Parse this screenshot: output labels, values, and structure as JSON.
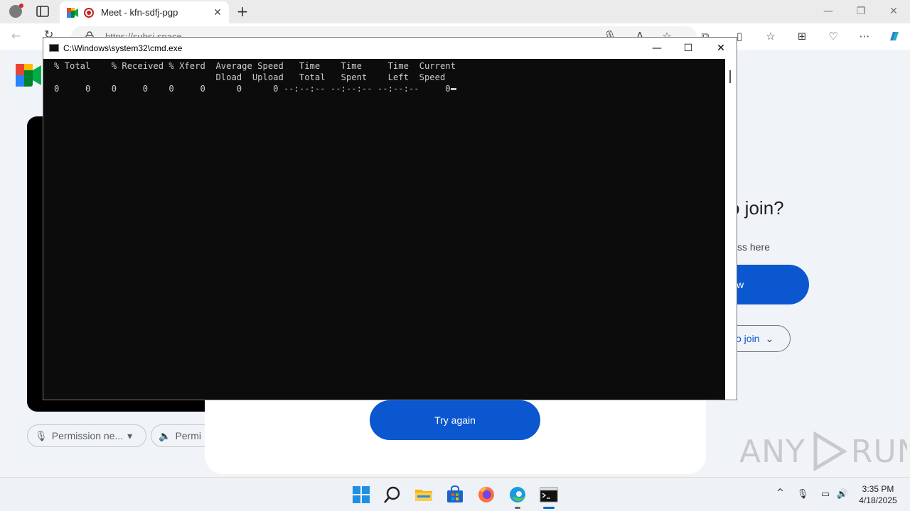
{
  "browser": {
    "tab": {
      "title": "Meet - kfn-sdfj-pgp",
      "close": "✕"
    },
    "new_tab": "+",
    "window_controls": {
      "minimize": "—",
      "restore": "❐",
      "close": "✕"
    },
    "back": "←",
    "reload": "↻",
    "url": "https://subsi.space",
    "toolbar_icons": [
      "microphone-icon",
      "read-aloud-icon",
      "favorite-star-icon",
      "extensions-icon",
      "split-screen-icon",
      "favorites-icon",
      "collections-icon",
      "browser-essentials-icon",
      "more-icon",
      "copilot-icon"
    ]
  },
  "meet": {
    "join_title": "o join?",
    "join_subtitle": "ss here",
    "join_now": "w",
    "other_ways": "o join",
    "permission_chips": [
      "Permission ne...",
      "Permi"
    ],
    "try_again": "Try again"
  },
  "watermark": {
    "text_left": "ANY",
    "text_right": "RUN"
  },
  "cmd": {
    "title": "C:\\Windows\\system32\\cmd.exe",
    "controls": {
      "minimize": "—",
      "maximize": "☐",
      "close": "✕"
    },
    "lines": [
      "% Total    % Received % Xferd  Average Speed   Time    Time     Time  Current",
      "                               Dload  Upload   Total   Spent    Left  Speed",
      "0     0    0     0    0     0      0      0 --:--:-- --:--:-- --:--:--     0"
    ]
  },
  "taskbar": {
    "apps": [
      "windows-start-icon",
      "search-icon",
      "file-explorer-icon",
      "microsoft-store-icon",
      "firefox-icon",
      "edge-icon",
      "cmd-icon"
    ],
    "tray_chevron": "^",
    "time": "3:35 PM",
    "date": "4/18/2025"
  }
}
